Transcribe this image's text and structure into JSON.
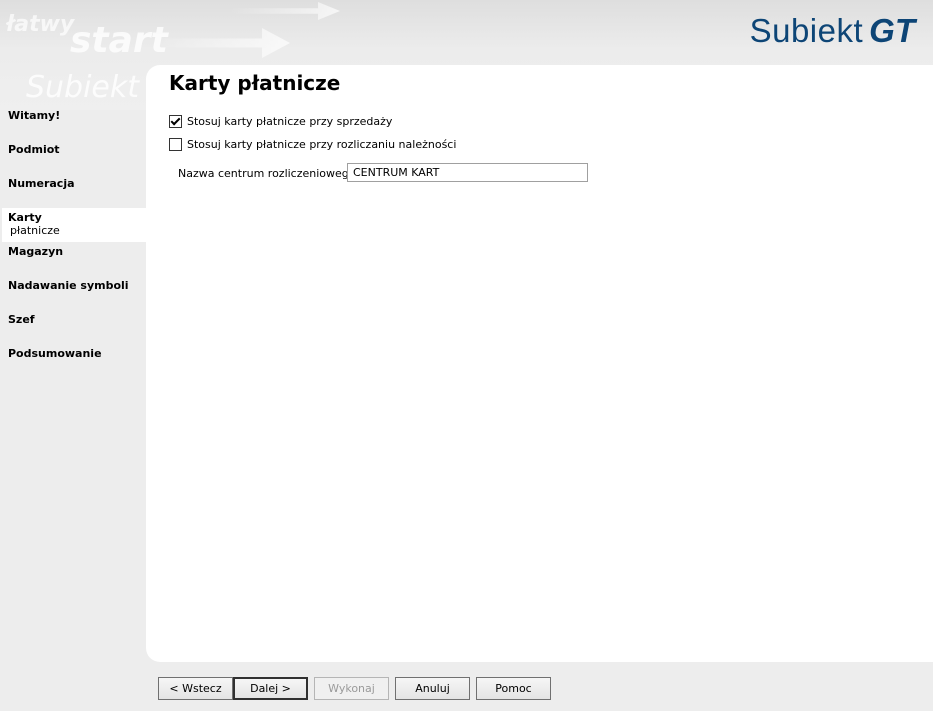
{
  "header": {
    "watermark": {
      "line1": "łatwy",
      "line2": "start",
      "line3": "Subiekt"
    },
    "logo": {
      "text": "Subiekt",
      "suffix": "GT",
      "color": "#0d4576"
    }
  },
  "sidebar": {
    "items": [
      {
        "label": "Witamy!",
        "active": false
      },
      {
        "label": "Podmiot",
        "active": false
      },
      {
        "label": "Numeracja",
        "active": false
      },
      {
        "label": "Karty",
        "sublabel": "płatnicze",
        "active": true
      },
      {
        "label": "Magazyn",
        "active": false
      },
      {
        "label": "Nadawanie symboli",
        "active": false
      },
      {
        "label": "Szef",
        "active": false
      },
      {
        "label": "Podsumowanie",
        "active": false
      }
    ]
  },
  "main": {
    "title": "Karty płatnicze",
    "checkbox_sales": {
      "label": "Stosuj karty płatnicze przy sprzedaży",
      "checked": true
    },
    "checkbox_receivables": {
      "label": "Stosuj karty płatnicze przy rozliczaniu należności",
      "checked": false
    },
    "center_name": {
      "label": "Nazwa centrum rozliczeniowego:",
      "value": "CENTRUM KART"
    }
  },
  "footer": {
    "back": "< Wstecz",
    "next": "Dalej >",
    "execute": "Wykonaj",
    "cancel": "Anuluj",
    "help": "Pomoc"
  }
}
